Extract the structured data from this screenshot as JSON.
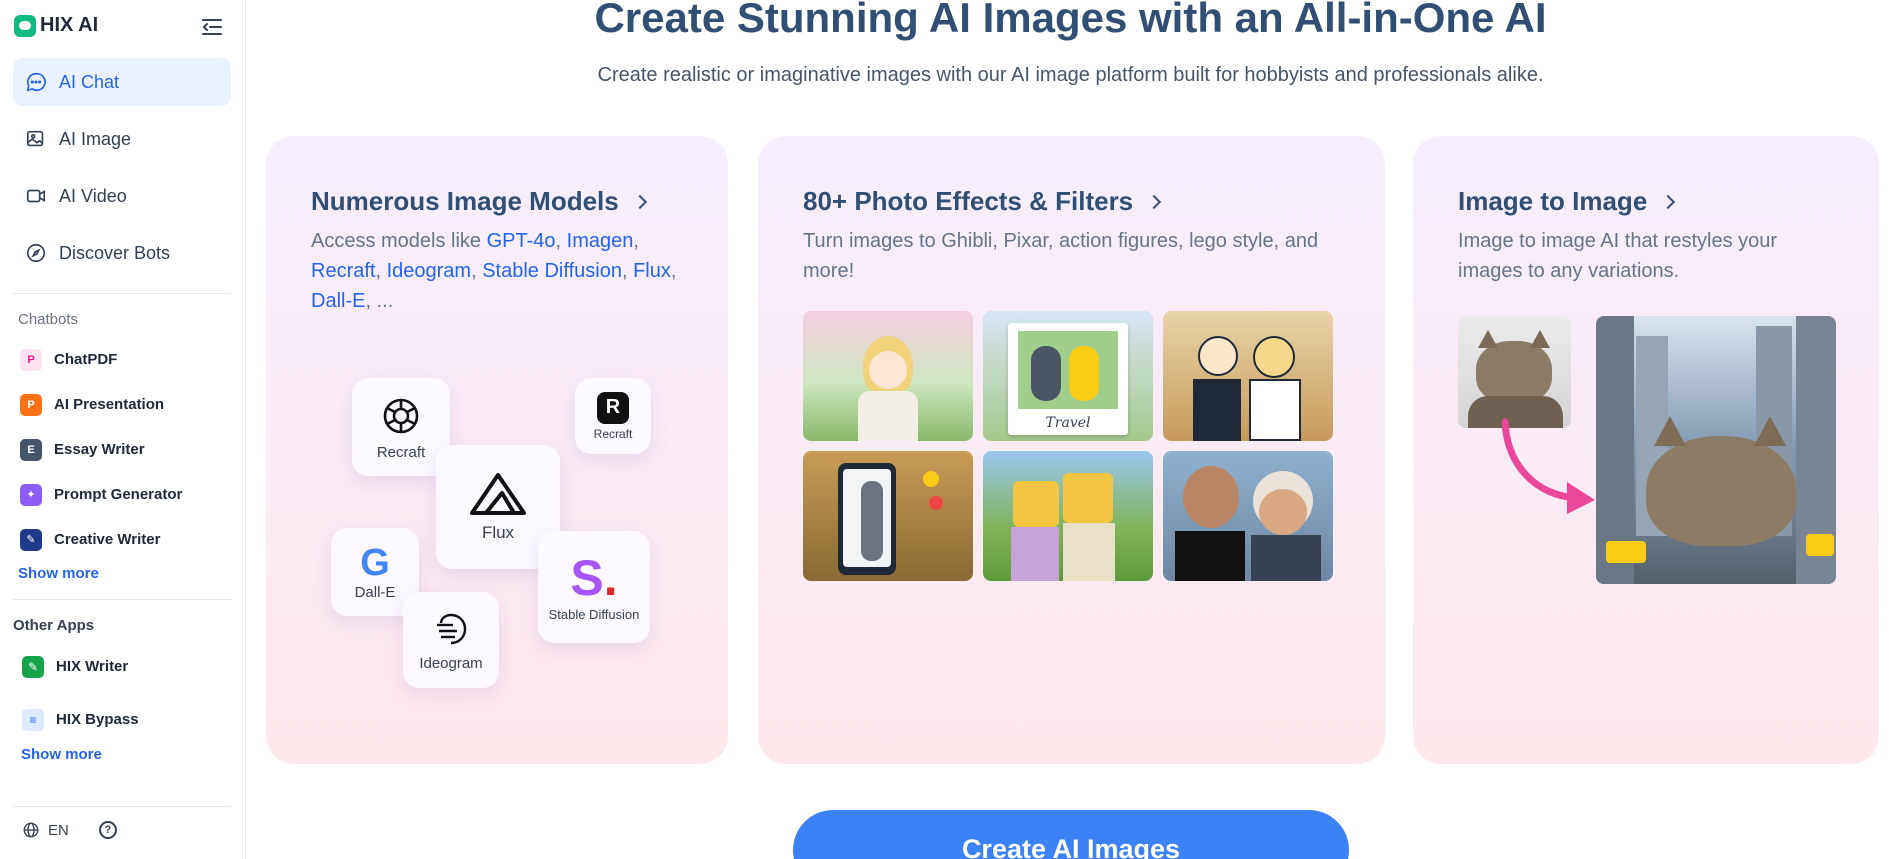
{
  "brand": {
    "name": "HIX AI"
  },
  "nav": [
    {
      "label": "AI Chat",
      "icon": "chat-icon",
      "active": true
    },
    {
      "label": "AI Image",
      "icon": "image-icon",
      "active": false
    },
    {
      "label": "AI Video",
      "icon": "video-icon",
      "active": false
    },
    {
      "label": "Discover Bots",
      "icon": "compass-icon",
      "active": false
    }
  ],
  "chatbots": {
    "title": "Chatbots",
    "items": [
      {
        "label": "ChatPDF",
        "icon": "pdf-icon"
      },
      {
        "label": "AI Presentation",
        "icon": "presentation-icon"
      },
      {
        "label": "Essay Writer",
        "icon": "essay-icon"
      },
      {
        "label": "Prompt Generator",
        "icon": "prompt-icon"
      },
      {
        "label": "Creative Writer",
        "icon": "creative-icon"
      }
    ],
    "show_more": "Show more"
  },
  "other_apps": {
    "title": "Other Apps",
    "items": [
      {
        "label": "HIX Writer",
        "icon": "writer-icon"
      },
      {
        "label": "HIX Bypass",
        "icon": "bypass-icon"
      }
    ],
    "show_more": "Show more"
  },
  "footer": {
    "language": "EN"
  },
  "hero": {
    "title": "Create Stunning AI Images with an All-in-One AI",
    "subtitle": "Create realistic or imaginative images with our AI image platform built for hobbyists and professionals alike."
  },
  "cards": {
    "models": {
      "title": "Numerous Image Models",
      "desc_prefix": "Access models like ",
      "links": [
        "GPT-4o",
        "Imagen",
        "Recraft",
        "Ideogram",
        "Stable Diffusion",
        "Flux",
        "Dall-E"
      ],
      "desc_suffix": "...",
      "tiles": [
        "Recraft",
        "Recraft",
        "Flux",
        "Dall-E",
        "Stable Diffusion",
        "Ideogram"
      ]
    },
    "effects": {
      "title": "80+ Photo Effects & Filters",
      "desc": "Turn images to Ghibli, Pixar, action figures, lego style, and more!",
      "polaroid_caption": "Travel"
    },
    "img2img": {
      "title": "Image to Image",
      "desc": "Image to image AI that restyles your images to any variations."
    }
  },
  "cta": {
    "label": "Create AI Images"
  },
  "colors": {
    "accent": "#2563eb",
    "active_bg": "#eaf2fe",
    "cta": "#3b82f6",
    "title": "#334e75"
  }
}
